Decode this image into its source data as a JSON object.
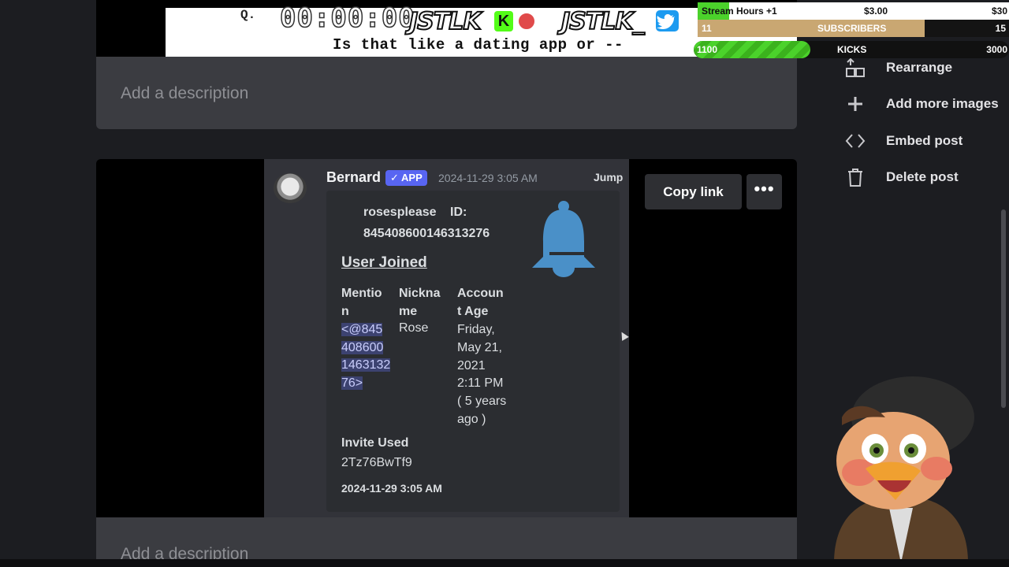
{
  "post_top": {
    "caption_q": "Q.",
    "caption_line": "Is that like a dating app or --"
  },
  "descriptions": [
    "Add a description",
    "Add a description"
  ],
  "message": {
    "bot_name": "Bernard",
    "badge": "✓ APP",
    "timestamp": "2024-11-29 3:05 AM",
    "jump_label": "Jump",
    "embed": {
      "author": "rosesplease",
      "id_label": "ID:",
      "id_value": "845408600146313276",
      "title": "User Joined",
      "col_mention": [
        "Mentio",
        "n"
      ],
      "col_nickname": [
        "Nickna",
        "me"
      ],
      "col_account_age": [
        "Accoun",
        "t Age"
      ],
      "mention_value": [
        "<@845",
        "408600",
        "1463132",
        "76>"
      ],
      "nickname_value": "Rose",
      "account_age_value": [
        "Friday,",
        "May 21,",
        "2021",
        "2:11 PM",
        "( 5 years",
        "ago )"
      ],
      "invite_label": "Invite Used",
      "invite_value": "2Tz76BwTf9",
      "footer_time": "2024-11-29 3:05 AM"
    }
  },
  "actions": {
    "copy_link": "Copy link",
    "more": "•••"
  },
  "sidebar": {
    "items": [
      {
        "label": "Rearrange",
        "icon": "rearrange-icon"
      },
      {
        "label": "Add more images",
        "icon": "plus-icon"
      },
      {
        "label": "Embed post",
        "icon": "code-icon"
      },
      {
        "label": "Delete post",
        "icon": "trash-icon"
      }
    ]
  },
  "overlay": {
    "timer": "00:00:00",
    "brand": "JSTLK",
    "brand_2": "JSTLK_",
    "kick_letter": "K",
    "goal_bar": {
      "label": "Stream Hours +1",
      "amount": "$3.00",
      "target": "$30",
      "progress": 0.1,
      "color": "#4bd22b"
    },
    "sub_bar": {
      "current": "11",
      "label": "SUBSCRIBERS",
      "target": "15",
      "progress": 0.73,
      "color": "#c9a772"
    },
    "kick_bar": {
      "current": "1100",
      "label": "KICKS",
      "target": "3000",
      "progress": 0.37,
      "color": "#4bd22b"
    }
  }
}
